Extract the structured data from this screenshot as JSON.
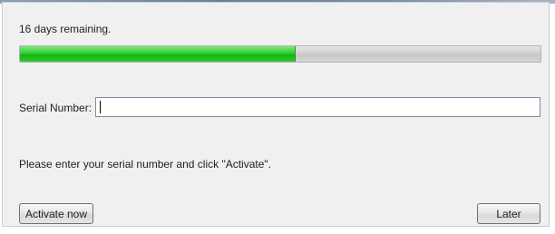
{
  "trial": {
    "days_remaining_text": "16 days remaining.",
    "progress_fraction": 0.53
  },
  "serial": {
    "label": "Serial Number:",
    "value": "",
    "placeholder": ""
  },
  "instructions": "Please enter your serial number and click \"Activate\".",
  "buttons": {
    "activate_label": "Activate now",
    "later_label": "Later"
  },
  "colors": {
    "progress_fill": "#22c022",
    "progress_track": "#cfcfcf",
    "dialog_background": "#f0f0f0"
  }
}
